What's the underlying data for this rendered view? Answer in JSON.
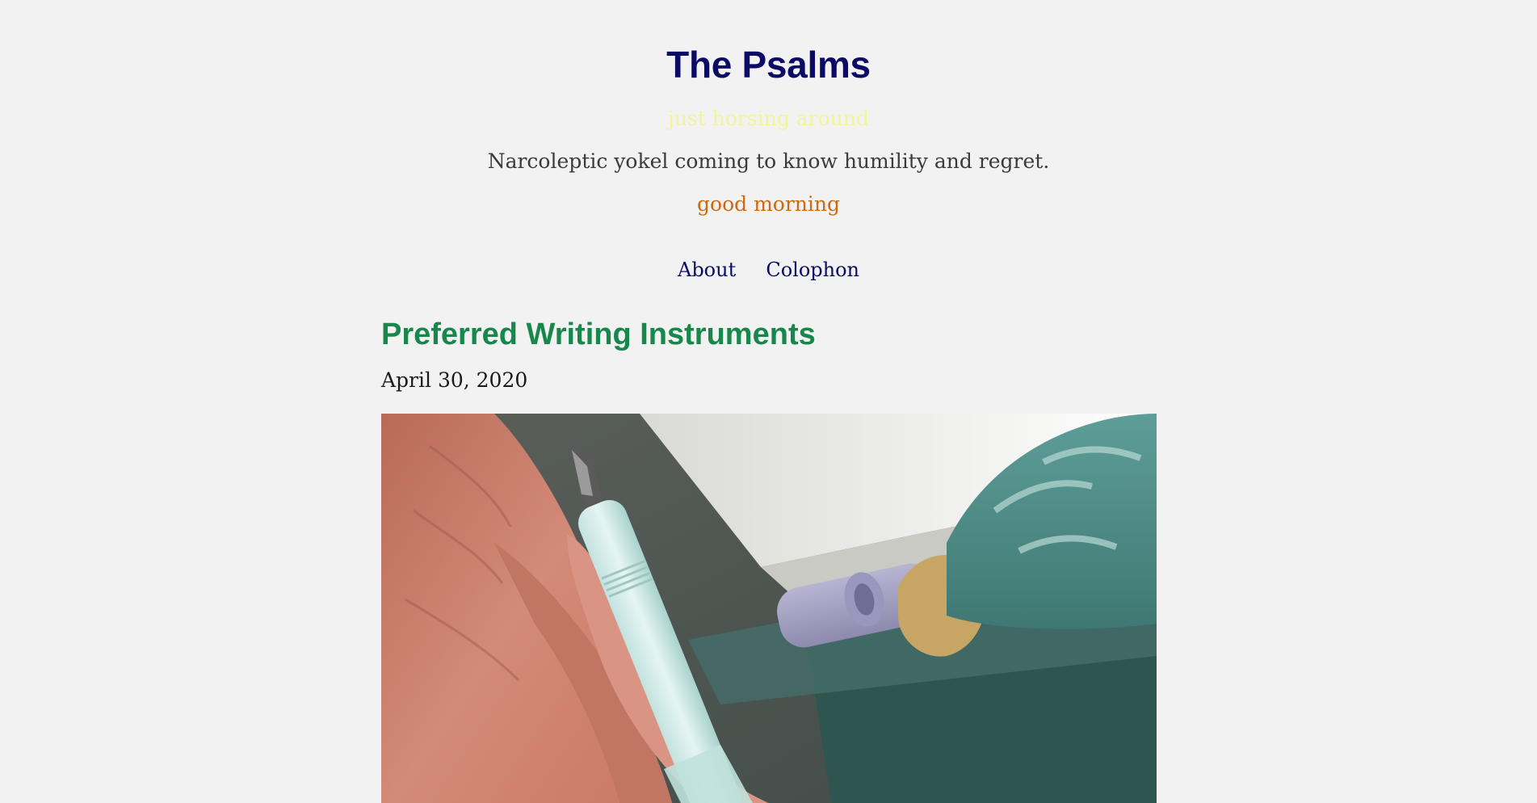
{
  "site": {
    "title": "The Psalms",
    "tagline": "just horsing around",
    "description": "Narcoleptic yokel coming to know humility and regret.",
    "greeting": "good morning"
  },
  "nav": {
    "items": [
      {
        "label": "About"
      },
      {
        "label": "Colophon"
      }
    ]
  },
  "post": {
    "title": "Preferred Writing Instruments",
    "date": "April 30, 2020",
    "image_subject": "hand holding a mint green fountain pen near a window with curtain"
  },
  "colors": {
    "background": "#f2f2f2",
    "site_title": "#0b0b66",
    "tagline": "#f1f59a",
    "greeting": "#cc6a10",
    "nav_link": "#0b0b66",
    "post_title": "#17874c"
  }
}
